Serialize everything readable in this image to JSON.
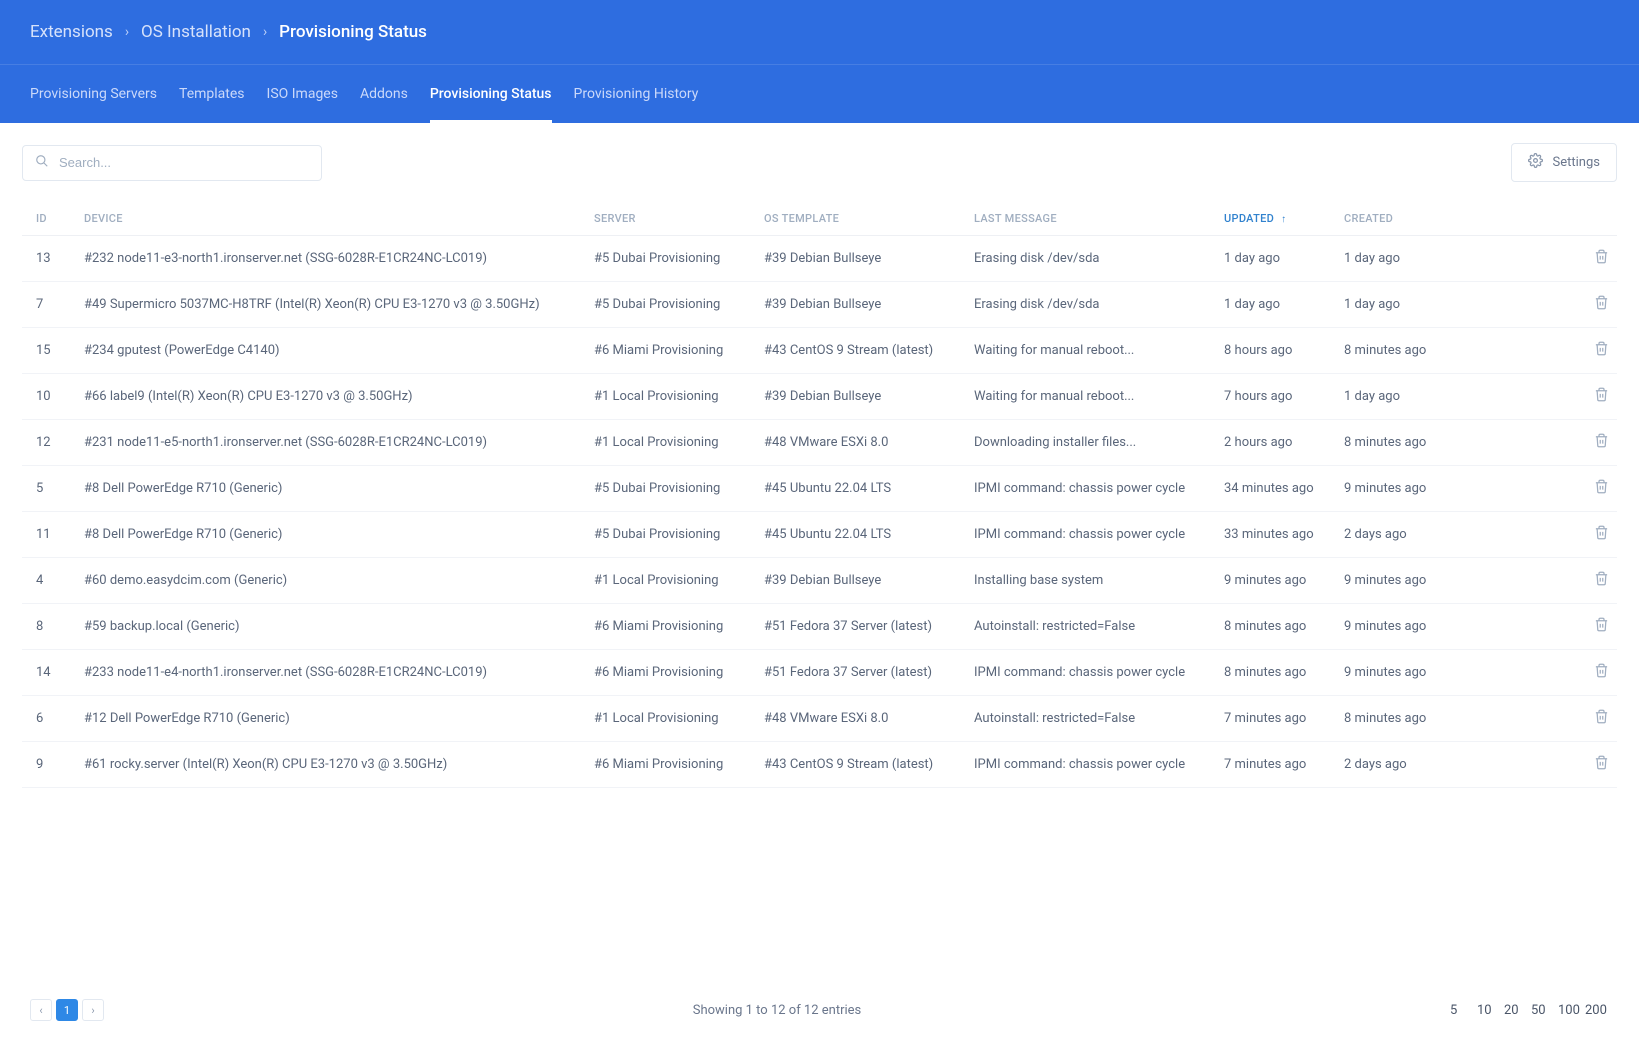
{
  "breadcrumb": {
    "items": [
      "Extensions",
      "OS Installation"
    ],
    "current": "Provisioning Status"
  },
  "tabs": [
    {
      "label": "Provisioning Servers",
      "active": false
    },
    {
      "label": "Templates",
      "active": false
    },
    {
      "label": "ISO Images",
      "active": false
    },
    {
      "label": "Addons",
      "active": false
    },
    {
      "label": "Provisioning Status",
      "active": true
    },
    {
      "label": "Provisioning History",
      "active": false
    }
  ],
  "search": {
    "placeholder": "Search..."
  },
  "settings_label": "Settings",
  "columns": {
    "id": "ID",
    "device": "DEVICE",
    "server": "SERVER",
    "os_template": "OS TEMPLATE",
    "last_message": "LAST MESSAGE",
    "updated": "UPDATED",
    "created": "CREATED"
  },
  "sort": {
    "column": "updated",
    "dir": "asc"
  },
  "rows": [
    {
      "id": "13",
      "device": "#232 node11-e3-north1.ironserver.net (SSG-6028R-E1CR24NC-LC019)",
      "server": "#5 Dubai Provisioning",
      "os_template": "#39 Debian Bullseye",
      "last_message": "Erasing disk /dev/sda",
      "updated": "1 day ago",
      "created": "1 day ago"
    },
    {
      "id": "7",
      "device": "#49 Supermicro 5037MC-H8TRF (Intel(R) Xeon(R) CPU E3-1270 v3 @ 3.50GHz)",
      "server": "#5 Dubai Provisioning",
      "os_template": "#39 Debian Bullseye",
      "last_message": "Erasing disk /dev/sda",
      "updated": "1 day ago",
      "created": "1 day ago"
    },
    {
      "id": "15",
      "device": "#234 gputest (PowerEdge C4140)",
      "server": "#6 Miami Provisioning",
      "os_template": "#43 CentOS 9 Stream (latest)",
      "last_message": "Waiting for manual reboot...",
      "updated": "8 hours ago",
      "created": "8 minutes ago"
    },
    {
      "id": "10",
      "device": "#66 label9 (Intel(R) Xeon(R) CPU E3-1270 v3 @ 3.50GHz)",
      "server": "#1 Local Provisioning",
      "os_template": "#39 Debian Bullseye",
      "last_message": "Waiting for manual reboot...",
      "updated": "7 hours ago",
      "created": "1 day ago"
    },
    {
      "id": "12",
      "device": "#231 node11-e5-north1.ironserver.net (SSG-6028R-E1CR24NC-LC019)",
      "server": "#1 Local Provisioning",
      "os_template": "#48 VMware ESXi 8.0",
      "last_message": "Downloading installer files...",
      "updated": "2 hours ago",
      "created": "8 minutes ago"
    },
    {
      "id": "5",
      "device": "#8 Dell PowerEdge R710 (Generic)",
      "server": "#5 Dubai Provisioning",
      "os_template": "#45 Ubuntu 22.04 LTS",
      "last_message": "IPMI command: chassis power cycle",
      "updated": "34 minutes ago",
      "created": "9 minutes ago"
    },
    {
      "id": "11",
      "device": "#8 Dell PowerEdge R710 (Generic)",
      "server": "#5 Dubai Provisioning",
      "os_template": "#45 Ubuntu 22.04 LTS",
      "last_message": "IPMI command: chassis power cycle",
      "updated": "33 minutes ago",
      "created": "2 days ago"
    },
    {
      "id": "4",
      "device": "#60 demo.easydcim.com (Generic)",
      "server": "#1 Local Provisioning",
      "os_template": "#39 Debian Bullseye",
      "last_message": "Installing base system",
      "updated": "9 minutes ago",
      "created": "9 minutes ago"
    },
    {
      "id": "8",
      "device": "#59 backup.local (Generic)",
      "server": "#6 Miami Provisioning",
      "os_template": "#51 Fedora 37 Server (latest)",
      "last_message": "Autoinstall: restricted=False",
      "updated": "8 minutes ago",
      "created": "9 minutes ago"
    },
    {
      "id": "14",
      "device": "#233 node11-e4-north1.ironserver.net (SSG-6028R-E1CR24NC-LC019)",
      "server": "#6 Miami Provisioning",
      "os_template": "#51 Fedora 37 Server (latest)",
      "last_message": "IPMI command: chassis power cycle",
      "updated": "8 minutes ago",
      "created": "9 minutes ago"
    },
    {
      "id": "6",
      "device": "#12 Dell PowerEdge R710 (Generic)",
      "server": "#1 Local Provisioning",
      "os_template": "#48 VMware ESXi 8.0",
      "last_message": "Autoinstall: restricted=False",
      "updated": "7 minutes ago",
      "created": "8 minutes ago"
    },
    {
      "id": "9",
      "device": "#61 rocky.server (Intel(R) Xeon(R) CPU E3-1270 v3 @ 3.50GHz)",
      "server": "#6 Miami Provisioning",
      "os_template": "#43 CentOS 9 Stream (latest)",
      "last_message": "IPMI command: chassis power cycle",
      "updated": "7 minutes ago",
      "created": "2 days ago"
    }
  ],
  "pagination": {
    "current_page": "1",
    "summary": "Showing 1 to 12 of 12 entries",
    "sizes": [
      "5",
      "10",
      "20",
      "50",
      "100",
      "200"
    ],
    "active_size": "20"
  }
}
